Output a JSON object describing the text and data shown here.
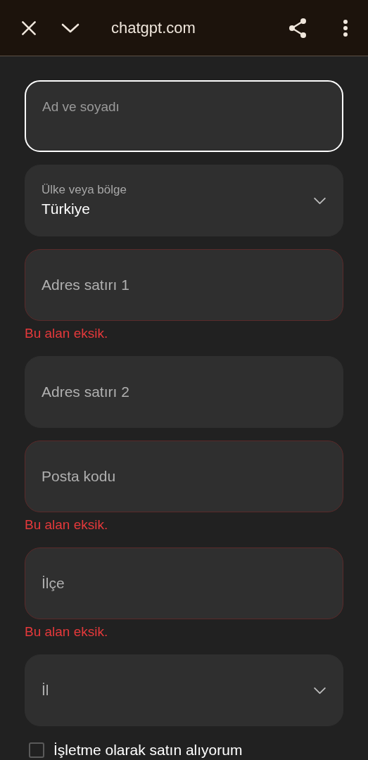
{
  "toolbar": {
    "url": "chatgpt.com"
  },
  "fields": [
    {
      "kind": "text",
      "label": "Ad ve soyadı",
      "focused": true,
      "invalid": false
    },
    {
      "kind": "select",
      "label": "Ülke veya bölge",
      "value": "Türkiye",
      "focused": false,
      "invalid": false
    },
    {
      "kind": "text",
      "label": "Adres satırı 1",
      "focused": false,
      "invalid": true,
      "error": "Bu alan eksik."
    },
    {
      "kind": "text",
      "label": "Adres satırı 2",
      "focused": false,
      "invalid": false
    },
    {
      "kind": "text",
      "label": "Posta kodu",
      "focused": false,
      "invalid": true,
      "error": "Bu alan eksik."
    },
    {
      "kind": "text",
      "label": "İlçe",
      "focused": false,
      "invalid": true,
      "error": "Bu alan eksik."
    },
    {
      "kind": "select",
      "label": "İl",
      "focused": false,
      "invalid": false
    }
  ],
  "business_checkbox": {
    "label": "İşletme olarak satın alıyorum",
    "checked": false
  }
}
